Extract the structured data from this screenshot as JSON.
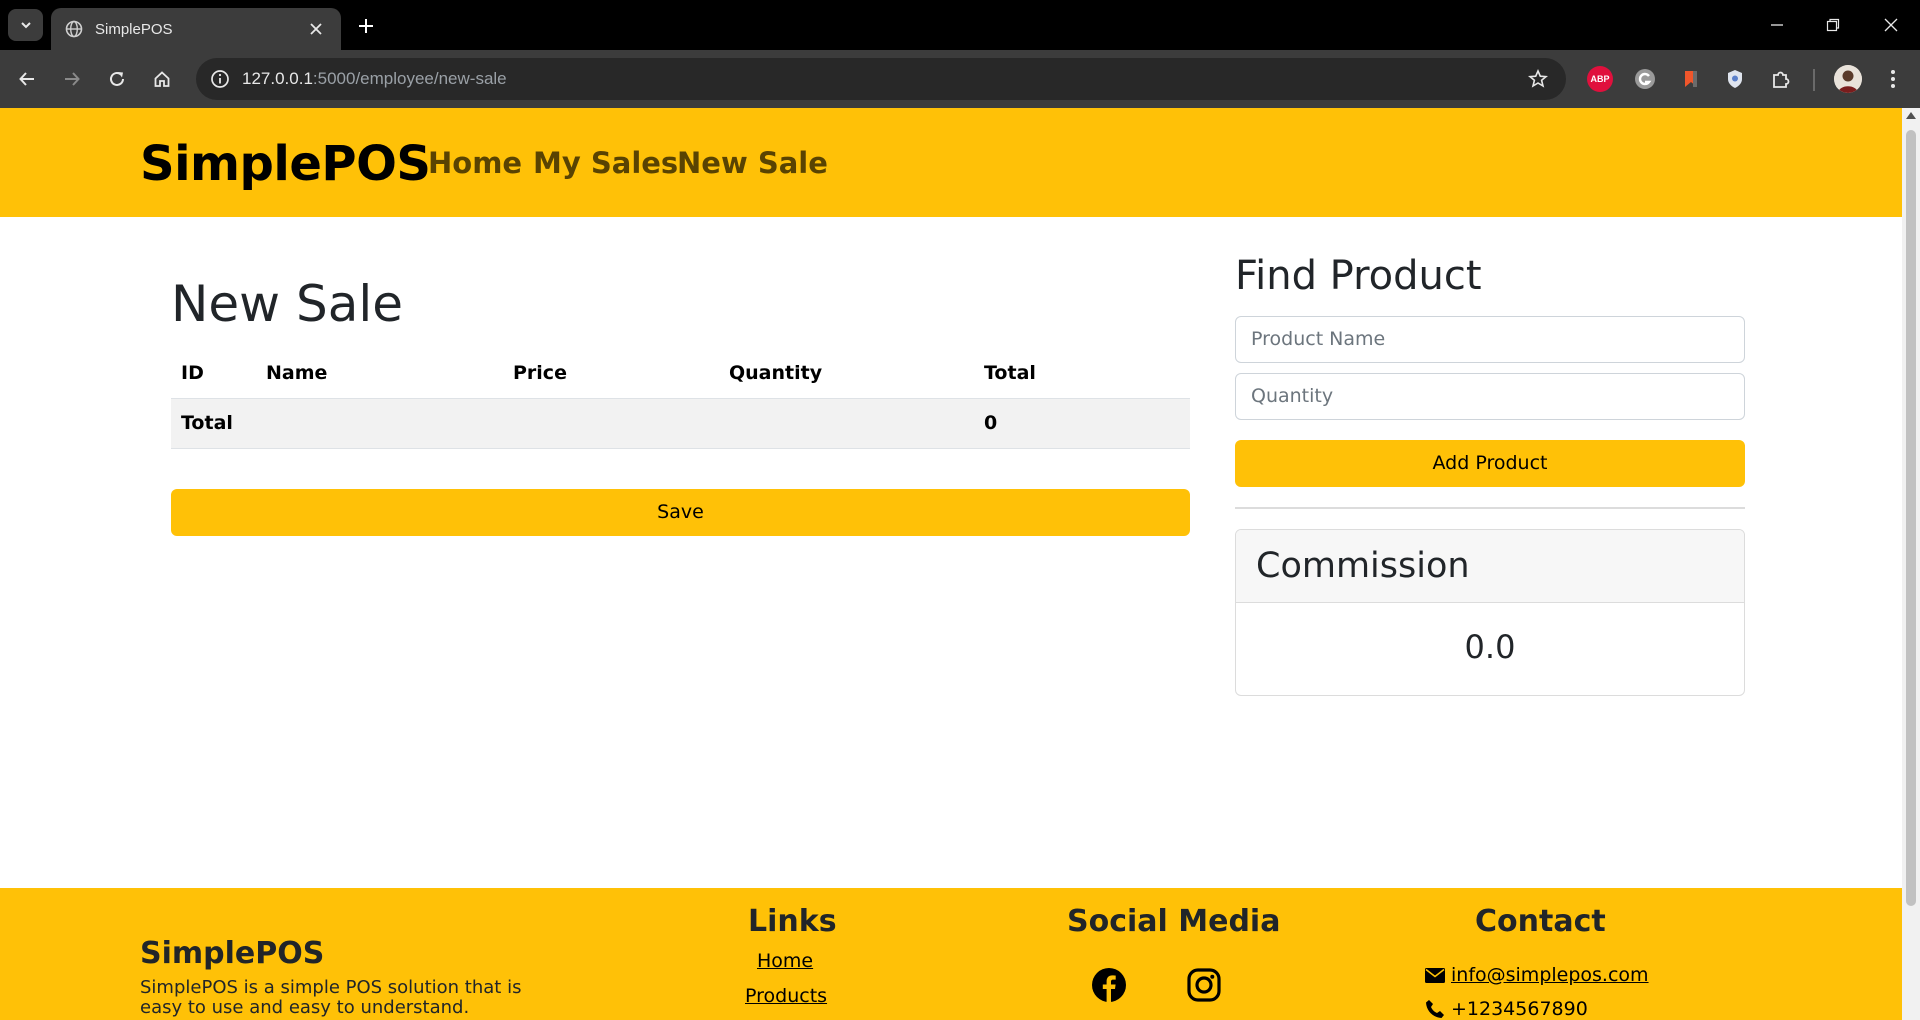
{
  "browser": {
    "tab_title": "SimplePOS",
    "url_host": "127.0.0.1",
    "url_path": ":5000/employee/new-sale",
    "extensions": {
      "abp_label": "ABP"
    }
  },
  "navbar": {
    "brand": "SimplePOS",
    "links": [
      "Home",
      "My Sales",
      "New Sale"
    ]
  },
  "sale": {
    "title": "New Sale",
    "columns": [
      "ID",
      "Name",
      "Price",
      "Quantity",
      "Total"
    ],
    "total_label": "Total",
    "total_value": "0",
    "save_label": "Save"
  },
  "find_product": {
    "title": "Find Product",
    "product_name_placeholder": "Product Name",
    "quantity_placeholder": "Quantity",
    "add_label": "Add Product"
  },
  "commission": {
    "title": "Commission",
    "value": "0.0"
  },
  "footer": {
    "brand": "SimplePOS",
    "description": "SimplePOS is a simple POS solution that is easy to use and easy to understand.",
    "links_heading": "Links",
    "links": [
      "Home",
      "Products"
    ],
    "social_heading": "Social Media",
    "social": [
      "facebook-icon",
      "instagram-icon"
    ],
    "contact_heading": "Contact",
    "email": " info@simplepos.com",
    "phone": "+1234567890"
  },
  "colors": {
    "accent": "#ffc107",
    "chrome_dark": "#3c3c3c"
  }
}
